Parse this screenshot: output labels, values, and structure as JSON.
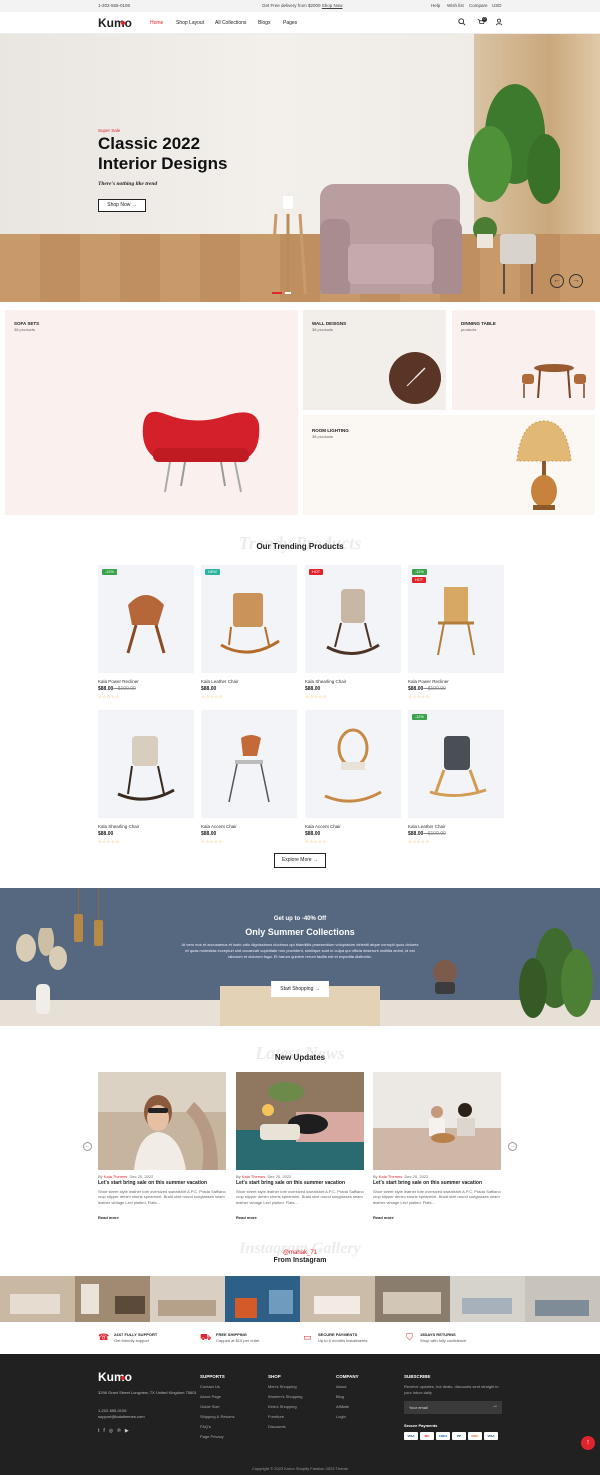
{
  "topbar": {
    "phone": "1-202-555-0106",
    "promo_prefix": "Get Free delivery from $2000",
    "promo_link": "Shop Now",
    "help": "Help",
    "wishlist": "Wish list",
    "compare": "Compare",
    "currency": "USD"
  },
  "header": {
    "logo": "Kumo",
    "nav": [
      "Home",
      "Shop Layout",
      "All Collections",
      "Blogs",
      "Pages"
    ],
    "cart_count": "0"
  },
  "hero": {
    "eyebrow": "Super Sale",
    "title_line1": "Classic 2022",
    "title_line2": "Interior Designs",
    "subtitle": "There's nothing like trend",
    "button": "Shop Now →"
  },
  "collections": [
    {
      "title": "SOFA SETS",
      "sub": "38 products"
    },
    {
      "title": "WALL DESIGNS",
      "sub": "38 products"
    },
    {
      "title": "DINNING TABLE",
      "sub": "products"
    },
    {
      "title": "ROOM LIGHTING",
      "sub": "38 products"
    }
  ],
  "trending": {
    "ghost": "Trendy Products",
    "title": "Our Trending Products",
    "explore": "Explore More →",
    "products": [
      {
        "name": "Kala Power Recliner",
        "price": "$88.00",
        "old": "$100.00",
        "badges": [
          {
            "text": "-12%",
            "color": "#3aa34a"
          }
        ]
      },
      {
        "name": "Kala Leather Chair",
        "price": "$88.00",
        "old": "",
        "badges": [
          {
            "text": "NEW",
            "color": "#2bb3a3"
          }
        ]
      },
      {
        "name": "Kala Shearling Chair",
        "price": "$88.00",
        "old": "",
        "badges": [
          {
            "text": "HOT",
            "color": "#e0242c"
          }
        ]
      },
      {
        "name": "Kala Power Recliner",
        "price": "$88.00",
        "old": "$100.00",
        "badges": [
          {
            "text": "-12%",
            "color": "#3aa34a"
          },
          {
            "text": "HOT",
            "color": "#e0242c"
          }
        ]
      },
      {
        "name": "Kala Shearling Chair",
        "price": "$88.00",
        "old": "",
        "badges": []
      },
      {
        "name": "Kala Accent Chair",
        "price": "$88.00",
        "old": "",
        "badges": []
      },
      {
        "name": "Kala Accent Chair",
        "price": "$88.00",
        "old": "",
        "badges": []
      },
      {
        "name": "Kala Leather Chair",
        "price": "$88.00",
        "old": "$100.00",
        "badges": [
          {
            "text": "-12%",
            "color": "#3aa34a"
          }
        ]
      }
    ],
    "stars": "☆☆☆☆☆"
  },
  "promo": {
    "eyebrow": "Get up to -40% Off",
    "title": "Only Summer Collections",
    "body": "At vero eos et accusamus et iusto odio dignissimos ducimus qui blanditiis praesentium voluptatum deleniti atque corrupti quos dolores et quas molestias excepturi sint occaecati cupiditate non provident, similique sunt in culpa qui officia deserunt mollitia animi, id est laborum et dolorum fuga. Et harum quidem rerum facilis est et expedita distinctio.",
    "button": "Start Shopping →"
  },
  "news": {
    "ghost": "Latest News",
    "title": "New Updates",
    "posts": [
      {
        "author": "Kala Themes",
        "date": "Dec 20, 2022",
        "title": "Let's start bring sale on this summer vacation",
        "excerpt": "Shoe street style leather tote oversized sweatshirt A.P.C. Prada Saffiano crop slipper denim shorts spearmint. Braid skirt round sunglasses seam leather vintage Levi plaited. Flats...",
        "more": "Read more"
      },
      {
        "author": "Kala Themes",
        "date": "Dec 20, 2022",
        "title": "Let's start bring sale on this summer vacation",
        "excerpt": "Shoe street style leather tote oversized sweatshirt A.P.C. Prada Saffiano crop slipper denim shorts spearmint. Braid skirt round sunglasses seam leather vintage Levi plaited. Flats...",
        "more": "Read more"
      },
      {
        "author": "Kala Themes",
        "date": "Dec 20, 2022",
        "title": "Let's start bring sale on this summer vacation",
        "excerpt": "Shoe street style leather tote oversized sweatshirt A.P.C. Prada Saffiano crop slipper denim shorts spearmint. Braid skirt round sunglasses seam leather vintage Levi plaited. Flats...",
        "more": "Read more"
      }
    ],
    "by": "By"
  },
  "instagram": {
    "ghost": "Instagram Gallery",
    "handle": "@mahak_71",
    "title": "From Instagram"
  },
  "features": [
    {
      "title": "24X7 FULLY SUPPORT",
      "sub": "Get friendly support"
    },
    {
      "title": "FREE SHIPPING",
      "sub": "Capped at $10 per order"
    },
    {
      "title": "SECURE PAYMENTS",
      "sub": "Up to 6 months installments"
    },
    {
      "title": "15DAYS RETURNS",
      "sub": "Shop with fully confidence"
    }
  ],
  "footer": {
    "logo": "Kumo",
    "address": "3298 Grant Street Longview, TX United Kingdom 75601",
    "phone": "1-202-555-0106",
    "email": "support@kalathemes.com",
    "support_title": "SUPPORTS",
    "support_links": [
      "Contact Us",
      "About Page",
      "Guide Size",
      "Shipping & Returns",
      "FAQ's",
      "Page Privacy"
    ],
    "shop_title": "SHOP",
    "shop_links": [
      "Men's Shopping",
      "Women's Shopping",
      "Kids's Shopping",
      "Furniture",
      "Discounts"
    ],
    "company_title": "COMPANY",
    "company_links": [
      "About",
      "Blog",
      "Affiliate",
      "Login"
    ],
    "subscribe_title": "SUBSCRIBE",
    "subscribe_text": "Receive updates, hot deals, discounts sent straight in your inbox daily",
    "email_placeholder": "Your email",
    "secure_title": "Secure Payments",
    "payments": [
      "VISA",
      "MC",
      "AMEX",
      "PP",
      "DISC",
      "VISA"
    ],
    "copyright": "Copyright © 2023 Kumo Shopify Fashion 2023 Theme"
  }
}
